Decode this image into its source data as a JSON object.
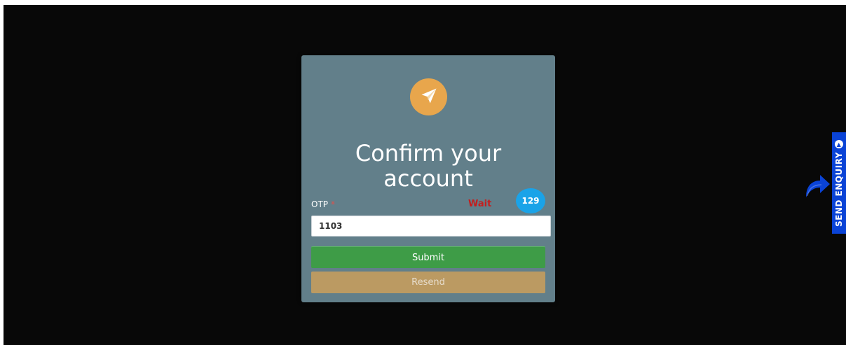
{
  "modal": {
    "logo_icon": "paper-plane-icon",
    "title": "Confirm your account",
    "otp_label": "OTP",
    "required_marker": "*",
    "wait_text": "Wait",
    "timer_value": "129",
    "otp_value": "1103",
    "submit_label": "Submit",
    "resend_label": "Resend"
  },
  "side_tab": {
    "label": "SEND ENQUIRY",
    "icon": "chevron-up-icon",
    "arrow_icon": "share-arrow-icon"
  },
  "colors": {
    "background": "#080808",
    "modal": "#627f8a",
    "logo": "#e8a64c",
    "timer": "#1aa3e8",
    "submit": "#3e9c47",
    "resend": "#bb9a62",
    "wait": "#c51d1d",
    "enquiry_tab": "#0a43d6"
  }
}
